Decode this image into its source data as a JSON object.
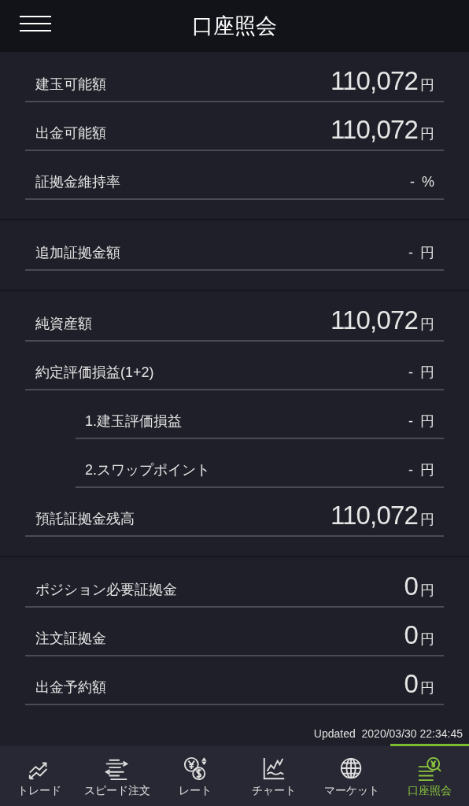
{
  "header": {
    "title": "口座照会"
  },
  "sections": [
    {
      "rows": [
        {
          "label": "建玉可能額",
          "value": "110,072",
          "unit": "円",
          "kind": "large"
        },
        {
          "label": "出金可能額",
          "value": "110,072",
          "unit": "円",
          "kind": "large"
        },
        {
          "label": "証拠金維持率",
          "value": "-",
          "unit": "%",
          "kind": "small"
        }
      ]
    },
    {
      "rows": [
        {
          "label": "追加証拠金額",
          "value": "-",
          "unit": "円",
          "kind": "small"
        }
      ]
    },
    {
      "rows": [
        {
          "label": "純資産額",
          "value": "110,072",
          "unit": "円",
          "kind": "large"
        },
        {
          "label": "約定評価損益(1+2)",
          "value": "-",
          "unit": "円",
          "kind": "small",
          "children": [
            {
              "label": "1.建玉評価損益",
              "value": "-",
              "unit": "円",
              "kind": "small"
            },
            {
              "label": "2.スワップポイント",
              "value": "-",
              "unit": "円",
              "kind": "small"
            }
          ]
        },
        {
          "label": "預託証拠金残高",
          "value": "110,072",
          "unit": "円",
          "kind": "large"
        }
      ]
    },
    {
      "rows": [
        {
          "label": "ポジション必要証拠金",
          "value": "0",
          "unit": "円",
          "kind": "large"
        },
        {
          "label": "注文証拠金",
          "value": "0",
          "unit": "円",
          "kind": "large"
        },
        {
          "label": "出金予約額",
          "value": "0",
          "unit": "円",
          "kind": "large"
        }
      ]
    }
  ],
  "updated": {
    "label": "Updated",
    "timestamp": "2020/03/30 22:34:45"
  },
  "nav": [
    {
      "label": "トレード",
      "selected": false
    },
    {
      "label": "スピード注文",
      "selected": false
    },
    {
      "label": "レート",
      "selected": false
    },
    {
      "label": "チャート",
      "selected": false
    },
    {
      "label": "マーケット",
      "selected": false
    },
    {
      "label": "口座照会",
      "selected": true
    }
  ]
}
